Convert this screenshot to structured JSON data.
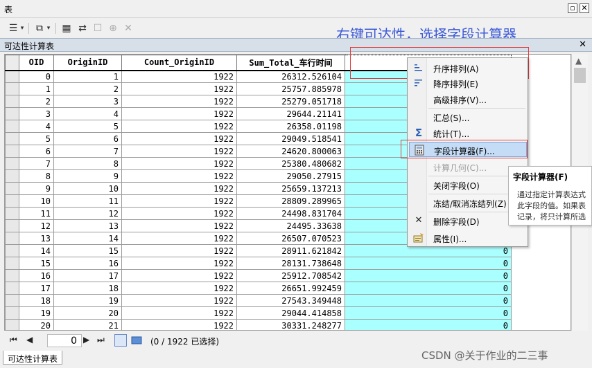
{
  "window": {
    "title": "表",
    "restore_icon": "restore-icon",
    "close_icon": "close-icon"
  },
  "toolbar": {
    "icons": [
      "table-options-icon",
      "dropdown-arrow-icon",
      "related-tables-icon",
      "dropdown-arrow-icon",
      "select-by-attributes-icon",
      "switch-selection-icon",
      "clear-selection-icon",
      "zoom-to-selected-icon",
      "delete-selected-icon"
    ]
  },
  "annotation": "右键可达性，选择字段计算器",
  "tab": {
    "title": "可达性计算表"
  },
  "table": {
    "columns": [
      "OID",
      "OriginID",
      "Count_OriginID",
      "Sum_Total_车行时间",
      ""
    ],
    "rows": [
      [
        "0",
        "1",
        "1922",
        "26312.526104",
        ""
      ],
      [
        "1",
        "2",
        "1922",
        "25757.885978",
        ""
      ],
      [
        "2",
        "3",
        "1922",
        "25279.051718",
        ""
      ],
      [
        "3",
        "4",
        "1922",
        "29644.21141",
        ""
      ],
      [
        "4",
        "5",
        "1922",
        "26358.01198",
        ""
      ],
      [
        "5",
        "6",
        "1922",
        "29049.518541",
        ""
      ],
      [
        "6",
        "7",
        "1922",
        "24620.800063",
        ""
      ],
      [
        "7",
        "8",
        "1922",
        "25380.480682",
        ""
      ],
      [
        "8",
        "9",
        "1922",
        "29050.27915",
        ""
      ],
      [
        "9",
        "10",
        "1922",
        "25659.137213",
        ""
      ],
      [
        "10",
        "11",
        "1922",
        "28809.289965",
        ""
      ],
      [
        "11",
        "12",
        "1922",
        "24498.831704",
        ""
      ],
      [
        "12",
        "13",
        "1922",
        "24495.33638",
        ""
      ],
      [
        "13",
        "14",
        "1922",
        "26507.070523",
        ""
      ],
      [
        "14",
        "15",
        "1922",
        "28911.621842",
        "0"
      ],
      [
        "15",
        "16",
        "1922",
        "28131.738648",
        "0"
      ],
      [
        "16",
        "17",
        "1922",
        "25912.708542",
        "0"
      ],
      [
        "17",
        "18",
        "1922",
        "26651.992459",
        "0"
      ],
      [
        "18",
        "19",
        "1922",
        "27543.349448",
        "0"
      ],
      [
        "19",
        "20",
        "1922",
        "29044.414858",
        "0"
      ],
      [
        "20",
        "21",
        "1922",
        "30331.248277",
        "0"
      ]
    ]
  },
  "context_menu": {
    "items": [
      {
        "label": "升序排列(A)",
        "icon": "sort-ascending-icon",
        "disabled": false
      },
      {
        "label": "降序排列(E)",
        "icon": "sort-descending-icon",
        "disabled": false
      },
      {
        "label": "高级排序(V)...",
        "icon": "",
        "disabled": false
      },
      {
        "label": "汇总(S)...",
        "icon": "",
        "disabled": false
      },
      {
        "label": "统计(T)...",
        "icon": "sigma-icon",
        "disabled": false
      },
      {
        "label": "字段计算器(F)...",
        "icon": "field-calculator-icon",
        "disabled": false,
        "highlighted": true
      },
      {
        "label": "计算几何(C)...",
        "icon": "",
        "disabled": true
      },
      {
        "label": "关闭字段(O)",
        "icon": "",
        "disabled": false
      },
      {
        "label": "冻结/取消冻结列(Z)",
        "icon": "",
        "disabled": false
      },
      {
        "label": "删除字段(D)",
        "icon": "delete-x-icon",
        "disabled": false
      },
      {
        "label": "属性(I)...",
        "icon": "properties-icon",
        "disabled": false
      }
    ]
  },
  "tooltip": {
    "title": "字段计算器(F)",
    "body": "通过指定计算表达式\n此字段的值。如果表\n记录，将只计算所选"
  },
  "statusbar": {
    "record": "0",
    "selection_text": "(0 / 1922 已选择)"
  },
  "bottom_tab": "可达性计算表",
  "watermark": "CSDN @关于作业的二三事",
  "colors": {
    "new_field_bg": "#aaffff",
    "highlight": "#c4dcf6",
    "annotation": "#3b5ad8",
    "outline": "#e03c3c"
  }
}
